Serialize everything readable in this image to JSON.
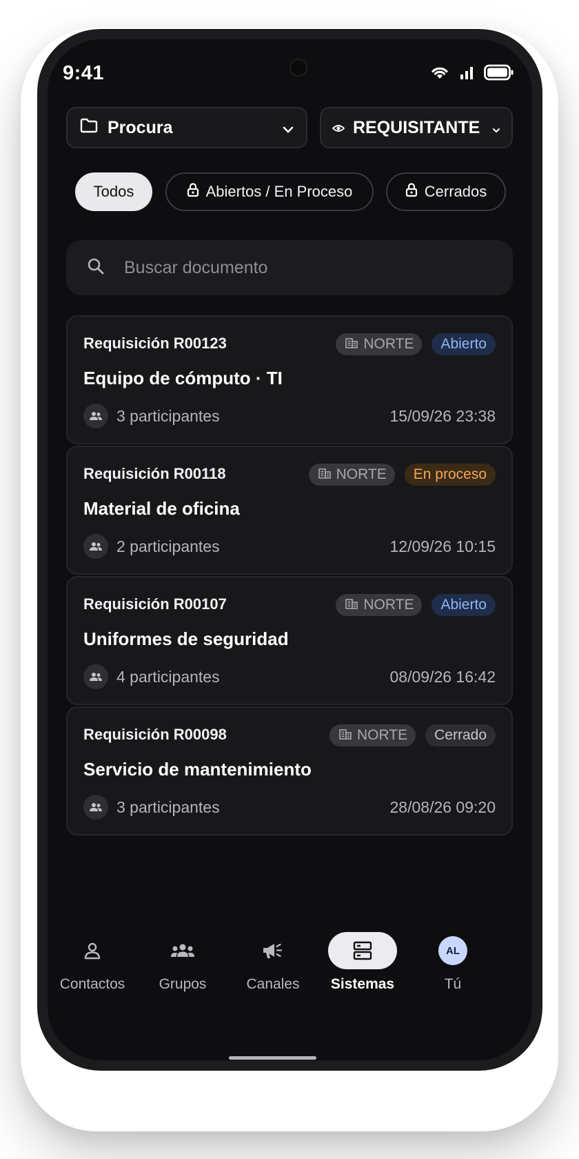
{
  "status_bar": {
    "time": "9:41"
  },
  "selectors": {
    "project": {
      "label": "Procura",
      "icon": "folder-icon"
    },
    "role": {
      "label": "REQUISITANTE",
      "icon": "eye-icon"
    }
  },
  "filters": [
    {
      "label": "Todos",
      "active": true
    },
    {
      "label": "Abiertos / En Proceso",
      "active": false,
      "icon": "lock-icon"
    },
    {
      "label": "Cerrados",
      "active": false,
      "icon": "lock-icon"
    }
  ],
  "search": {
    "placeholder": "Buscar documento",
    "value": ""
  },
  "documents": [
    {
      "code": "Requisición R00123",
      "zone": "NORTE",
      "status": "Abierto",
      "title": "Equipo de cómputo · TI",
      "participants": "3 participantes",
      "date": "15/09/26 23:38"
    },
    {
      "code": "Requisición R00118",
      "zone": "NORTE",
      "status": "En proceso",
      "title": "Material de oficina",
      "participants": "2 participantes",
      "date": "12/09/26 10:15"
    },
    {
      "code": "Requisición R00107",
      "zone": "NORTE",
      "status": "Abierto",
      "title": "Uniformes de seguridad",
      "participants": "4 participantes",
      "date": "08/09/26 16:42"
    },
    {
      "code": "Requisición R00098",
      "zone": "NORTE",
      "status": "Cerrado",
      "title": "Servicio de mantenimiento",
      "participants": "3 participantes",
      "date": "28/08/26 09:20"
    }
  ],
  "nav": [
    {
      "label": "Contactos",
      "icon": "person-icon"
    },
    {
      "label": "Grupos",
      "icon": "group-icon"
    },
    {
      "label": "Canales",
      "icon": "megaphone-icon"
    },
    {
      "label": "Sistemas",
      "icon": "server-icon",
      "active": true
    },
    {
      "label": "Tú",
      "avatar": "AL"
    }
  ],
  "colors": {
    "background": "#0e0e10",
    "card": "#18181b",
    "status_open": "#8fb4f2",
    "status_progress": "#f3a65a",
    "status_closed": "#c4c4c9",
    "avatar": "#c9d7ff"
  }
}
